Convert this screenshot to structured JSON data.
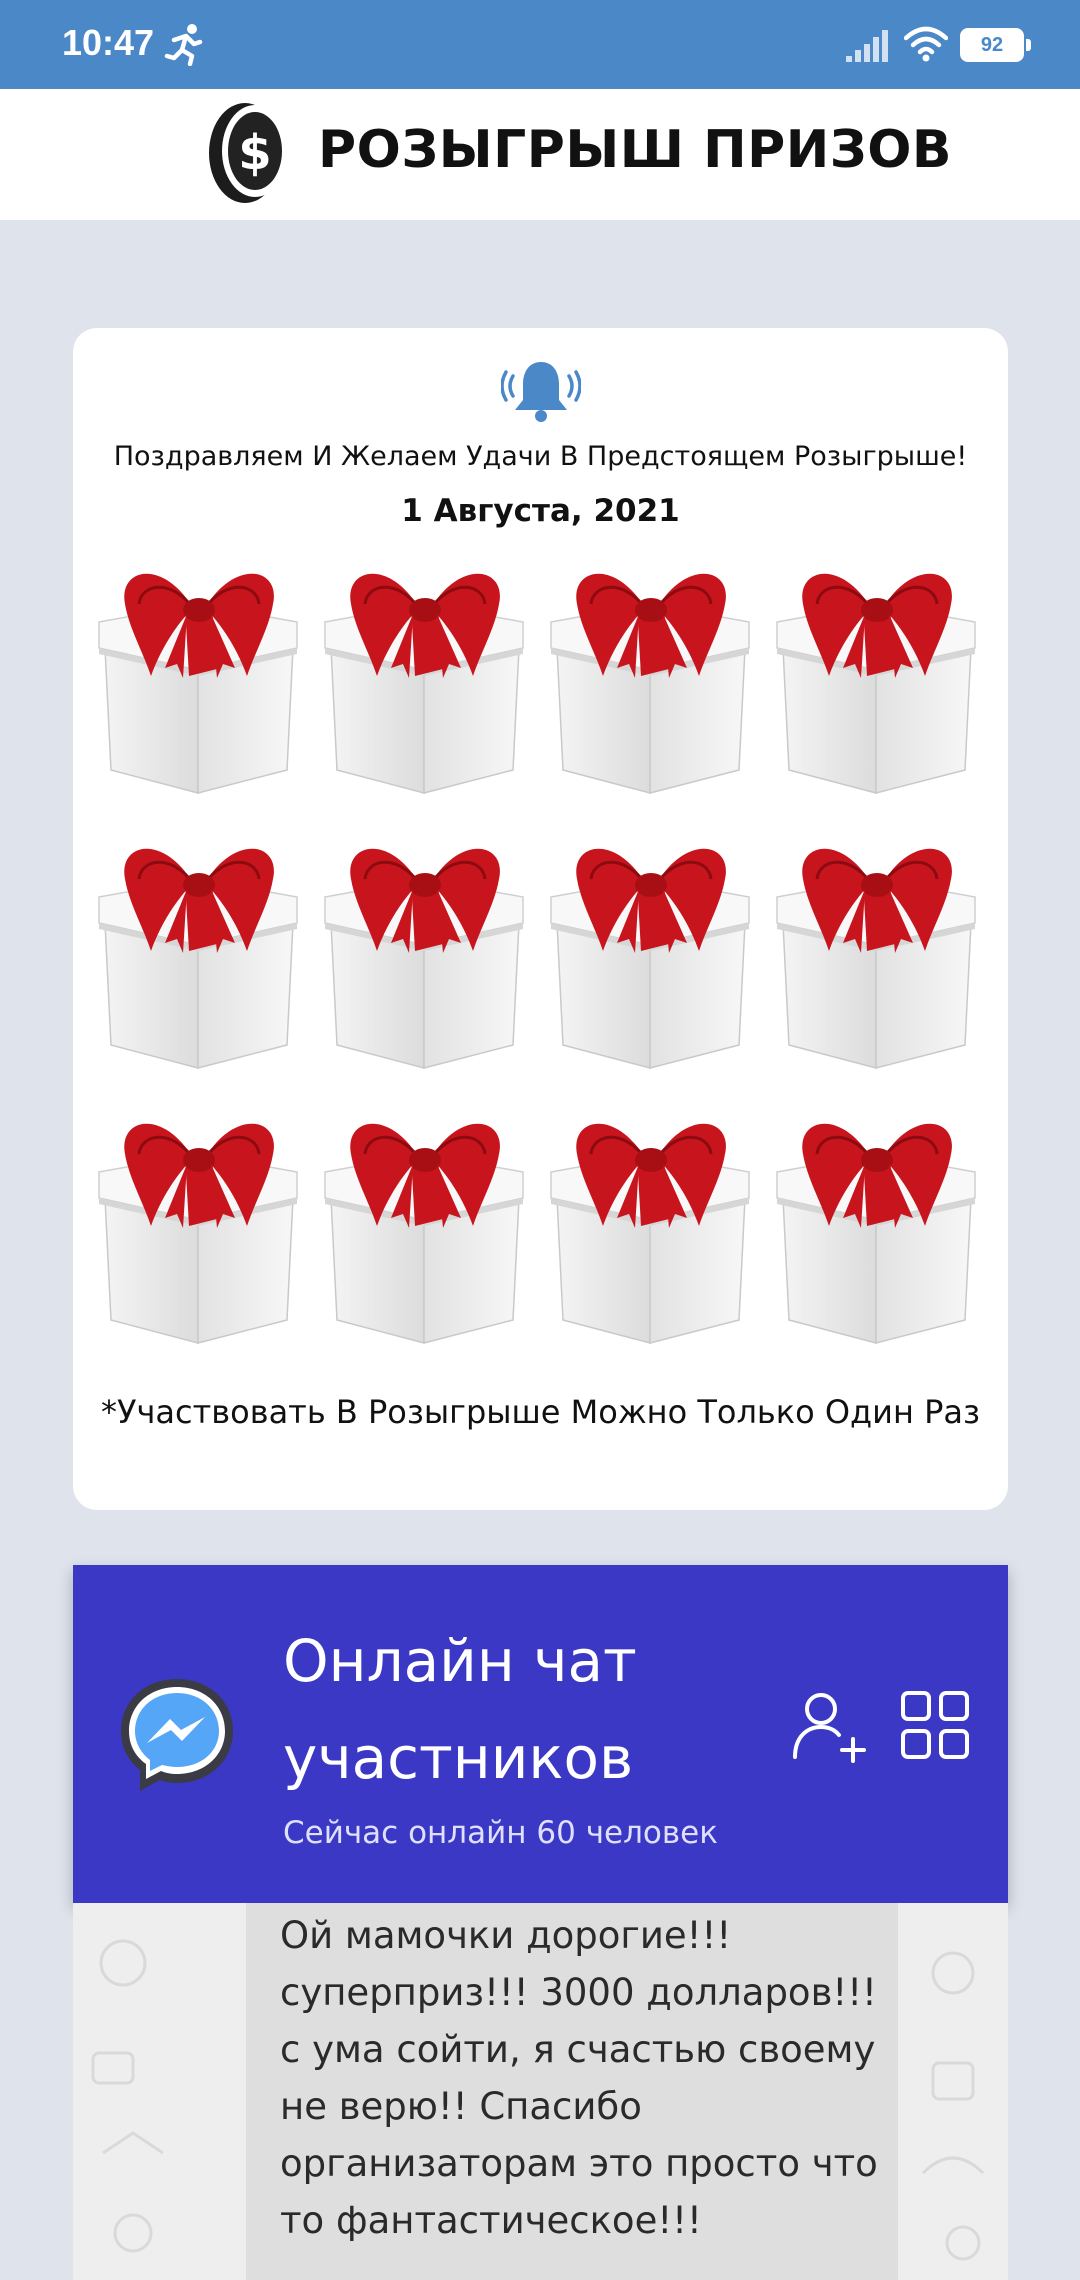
{
  "status_bar": {
    "time": "10:47",
    "battery": "92",
    "icons": [
      "running-icon",
      "signal-icon",
      "wifi-icon",
      "battery-icon"
    ]
  },
  "header": {
    "title": "РОЗЫГРЫШ ПРИЗОВ",
    "logo_icon": "dollar-coin-icon"
  },
  "prize_card": {
    "bell_icon": "bell-icon",
    "congrats": "Поздравляем И Желаем Удачи В Предстоящем Розыгрыше!",
    "date": "1 Августа, 2021",
    "gift_count": 12,
    "disclaimer": "*Участвовать В Розыгрыше Можно Только Один Раз"
  },
  "chat": {
    "title": "Онлайн чат участников",
    "online": "Сейчас онлайн 60 человек",
    "icons": [
      "messenger-icon",
      "add-user-icon",
      "grid-icon"
    ],
    "message": "Ой мамочки дорогие!!! суперприз!!! 3000 долларов!!! с ума сойти, я счастью своему не верю!! Спасибо организаторам это просто что то фантастическое!!!"
  },
  "colors": {
    "status_bar": "#4a88c8",
    "page_bg": "#dfe3ec",
    "chat_header": "#3a38c4",
    "ribbon": "#c8141c"
  }
}
